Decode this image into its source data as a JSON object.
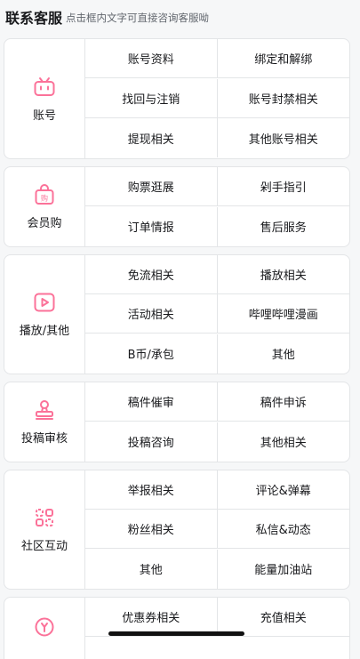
{
  "header": {
    "title": "联系客服",
    "hint": "点击框内文字可直接咨询客服呦"
  },
  "categories": [
    {
      "label": "账号",
      "icon": "tv-icon",
      "items": [
        "账号资料",
        "绑定和解绑",
        "找回与注销",
        "账号封禁相关",
        "提现相关",
        "其他账号相关"
      ]
    },
    {
      "label": "会员购",
      "icon": "shopping-bag-icon",
      "items": [
        "购票逛展",
        "剁手指引",
        "订单情报",
        "售后服务"
      ]
    },
    {
      "label": "播放/其他",
      "icon": "play-icon",
      "items": [
        "免流相关",
        "播放相关",
        "活动相关",
        "哔哩哔哩漫画",
        "B币/承包",
        "其他"
      ]
    },
    {
      "label": "投稿审核",
      "icon": "stamp-icon",
      "items": [
        "稿件催审",
        "稿件申诉",
        "投稿咨询",
        "其他相关"
      ]
    },
    {
      "label": "社区互动",
      "icon": "community-icon",
      "items": [
        "举报相关",
        "评论&弹幕",
        "粉丝相关",
        "私信&动态",
        "其他",
        "能量加油站"
      ]
    },
    {
      "label": "",
      "icon": "wallet-icon",
      "items": [
        "优惠券相关",
        "充值相关"
      ]
    }
  ],
  "colors": {
    "accent": "#fb7299",
    "border": "#e3e5e7",
    "background": "#f6f7f8"
  }
}
